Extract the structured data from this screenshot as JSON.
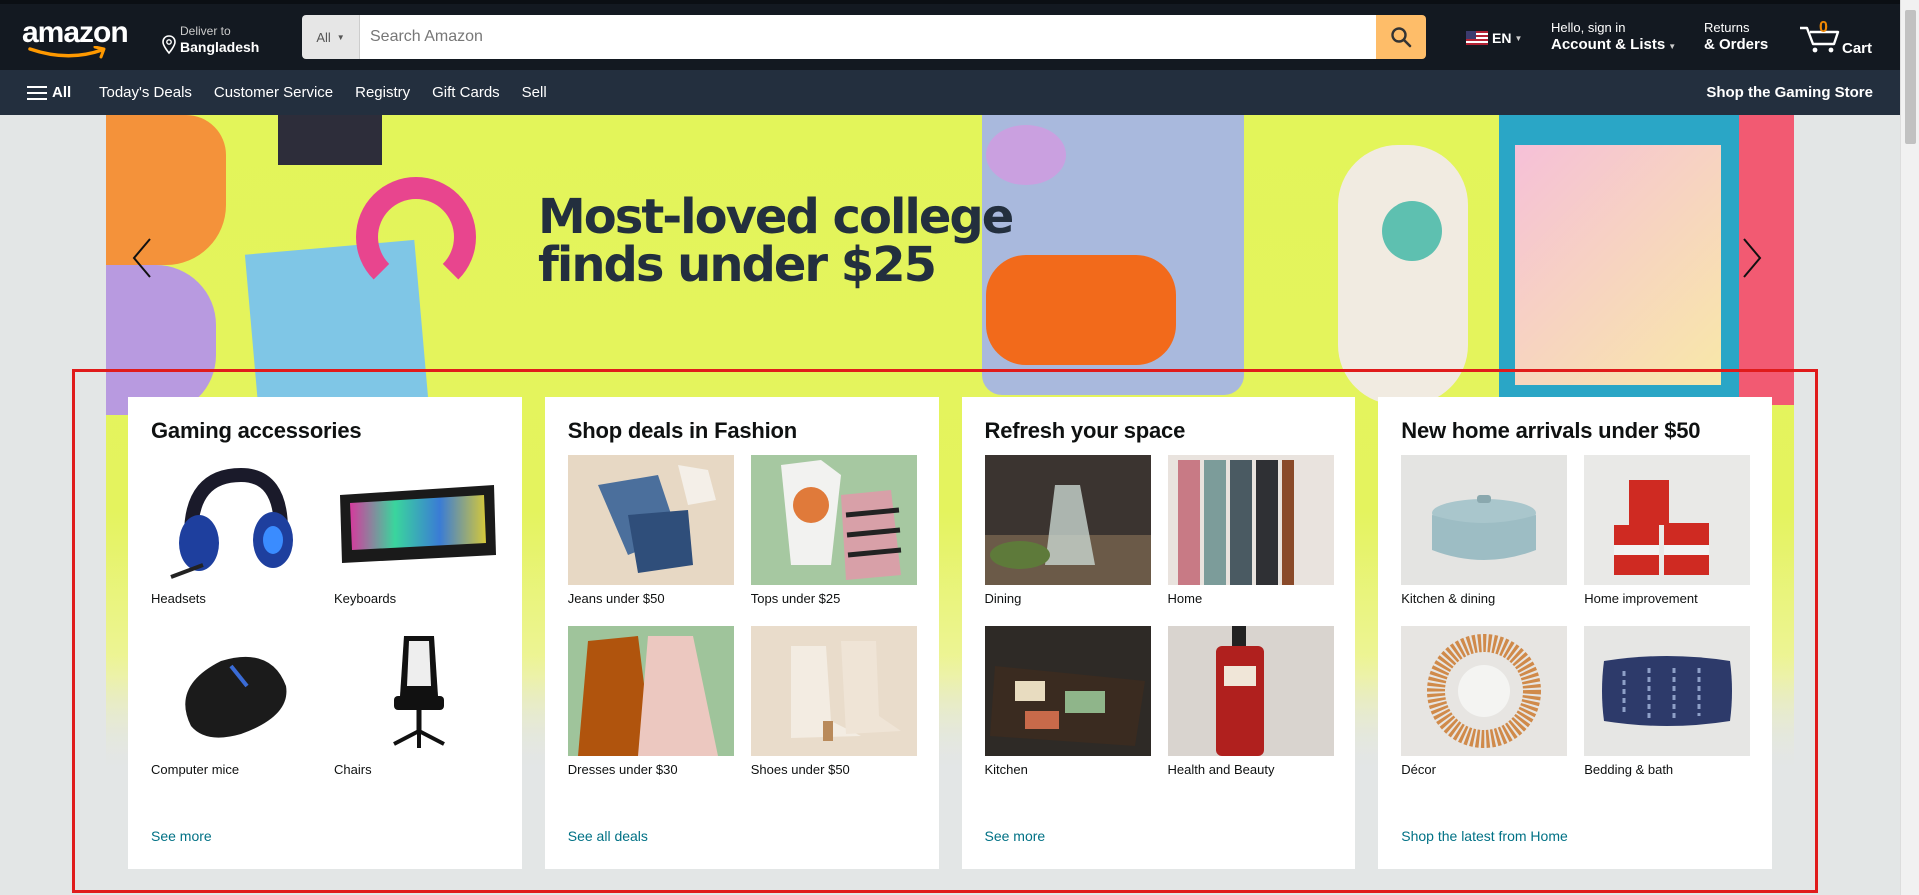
{
  "header": {
    "logo_text": "amazon",
    "deliver_line1": "Deliver to",
    "deliver_line2": "Bangladesh",
    "search_category": "All",
    "search_placeholder": "Search Amazon",
    "language": "EN",
    "account_line1": "Hello, sign in",
    "account_line2": "Account & Lists",
    "returns_line1": "Returns",
    "returns_line2": "& Orders",
    "cart_count": "0",
    "cart_label": "Cart"
  },
  "subnav": {
    "all_label": "All",
    "items": [
      "Today's Deals",
      "Customer Service",
      "Registry",
      "Gift Cards",
      "Sell"
    ],
    "promo": "Shop the Gaming Store"
  },
  "hero": {
    "line1": "Most-loved college",
    "line2": "finds under $25"
  },
  "cards": [
    {
      "title": "Gaming accessories",
      "items": [
        "Headsets",
        "Keyboards",
        "Computer mice",
        "Chairs"
      ],
      "link": "See more"
    },
    {
      "title": "Shop deals in Fashion",
      "items": [
        "Jeans under $50",
        "Tops under $25",
        "Dresses under $30",
        "Shoes under $50"
      ],
      "link": "See all deals"
    },
    {
      "title": "Refresh your space",
      "items": [
        "Dining",
        "Home",
        "Kitchen",
        "Health and Beauty"
      ],
      "link": "See more"
    },
    {
      "title": "New home arrivals under $50",
      "items": [
        "Kitchen & dining",
        "Home improvement",
        "Décor",
        "Bedding & bath"
      ],
      "link": "Shop the latest from Home"
    }
  ],
  "colors": {
    "header_bg": "#131921",
    "subnav_bg": "#232f3e",
    "search_button": "#febd69",
    "cart_count": "#f08804",
    "link": "#007185",
    "highlight_border": "#e01b1b",
    "hero_bg": "#e3f55a"
  }
}
